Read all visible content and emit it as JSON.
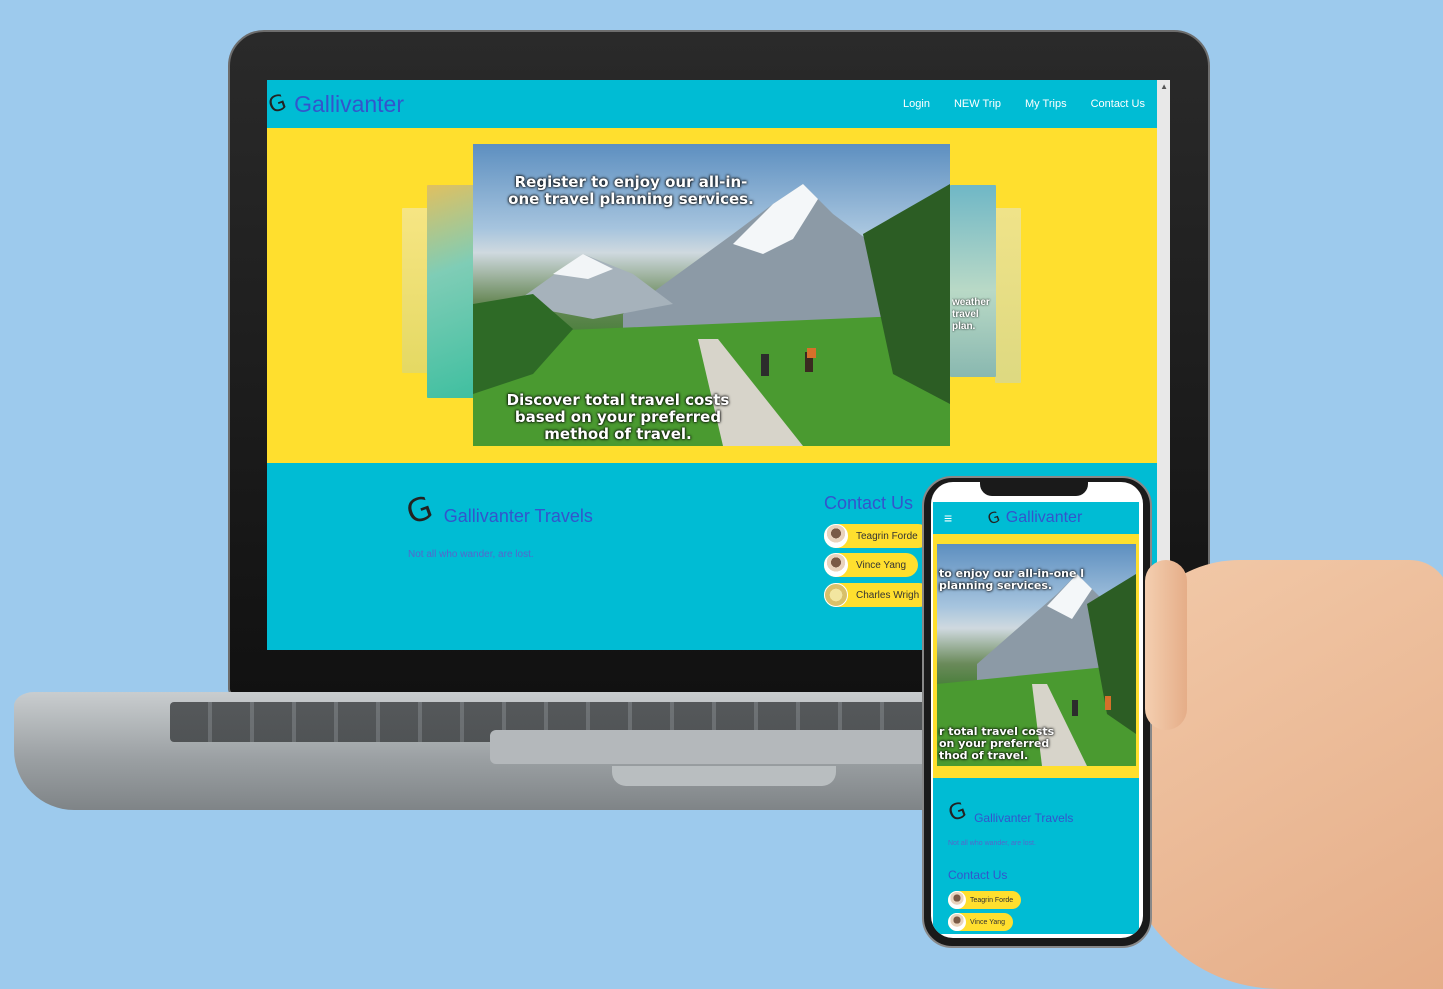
{
  "site": {
    "brand": "Gallivanter",
    "nav": [
      "Login",
      "NEW Trip",
      "My Trips",
      "Contact Us"
    ],
    "hero_caption_top": "Register to enjoy our all-in-one travel planning services.",
    "hero_caption_bottom": "Discover total travel costs based on your preferred method of travel.",
    "side_card_text": "weather travel plan.",
    "footer_title": "Gallivanter Travels",
    "footer_tagline": "Not all who wander, are lost.",
    "contact_heading": "Contact Us",
    "contacts": [
      "Teagrin Forde",
      "Vince Yang",
      "Charles Wrigh"
    ]
  },
  "phone": {
    "brand": "Gallivanter",
    "menu_icon": "≡",
    "hero_caption_top": "to enjoy our all-in-one l planning services.",
    "hero_caption_bottom": "r total travel costs on your preferred thod of travel.",
    "footer_title": "Gallivanter Travels",
    "footer_tagline": "Not all who wander, are lost.",
    "contact_heading": "Contact Us",
    "contacts": [
      "Teagrin Forde",
      "Vince Yang"
    ]
  },
  "colors": {
    "background": "#9dcaed",
    "nav": "#00bcd4",
    "hero": "#ffdf2e",
    "brand_text": "#3355cc"
  }
}
